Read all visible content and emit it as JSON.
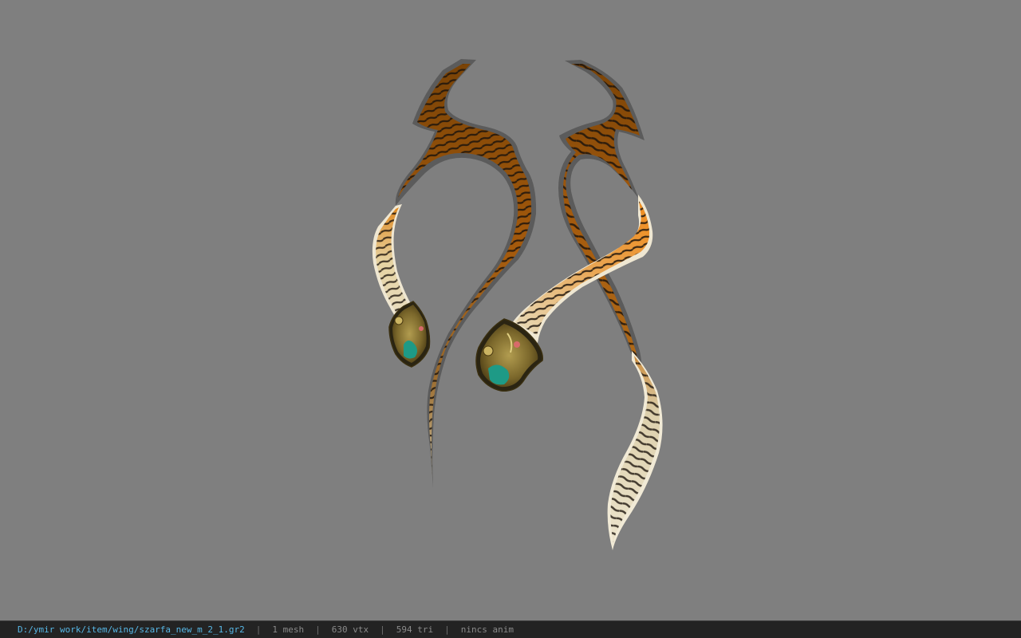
{
  "status_bar": {
    "file_path": "D:/ymir work/item/wing/szarfa_new_m_2_1.gr2",
    "separator": "|",
    "mesh_count": "1 mesh",
    "vertex_count": "630 vtx",
    "triangle_count": "594 tri",
    "animation": "nincs anim"
  },
  "colors": {
    "viewport_background": "#7f7f7f",
    "status_bar_background": "#232323",
    "path_text": "#57b7e6",
    "status_text": "#8a8a8a"
  }
}
